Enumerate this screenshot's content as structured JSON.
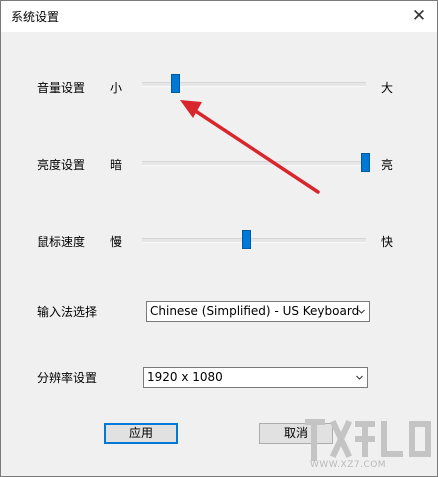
{
  "window": {
    "title": "系统设置",
    "close_glyph": "✕"
  },
  "volume": {
    "label": "音量设置",
    "min_label": "小",
    "max_label": "大",
    "value_percent": 15
  },
  "brightness": {
    "label": "亮度设置",
    "min_label": "暗",
    "max_label": "亮",
    "value_percent": 100
  },
  "mouse_speed": {
    "label": "鼠标速度",
    "min_label": "慢",
    "max_label": "快",
    "value_percent": 47
  },
  "input_method": {
    "label": "输入法选择",
    "selected": "Chinese (Simplified) - US Keyboard"
  },
  "resolution": {
    "label": "分辨率设置",
    "selected": "1920 x 1080"
  },
  "buttons": {
    "apply": "应用",
    "cancel": "取消"
  },
  "annotation": {
    "arrow_color": "#d9262c"
  },
  "watermark": {
    "text": "WWW.XZ7.COM"
  },
  "colors": {
    "accent": "#0078d7",
    "dialog_bg": "#f0f0f0"
  }
}
